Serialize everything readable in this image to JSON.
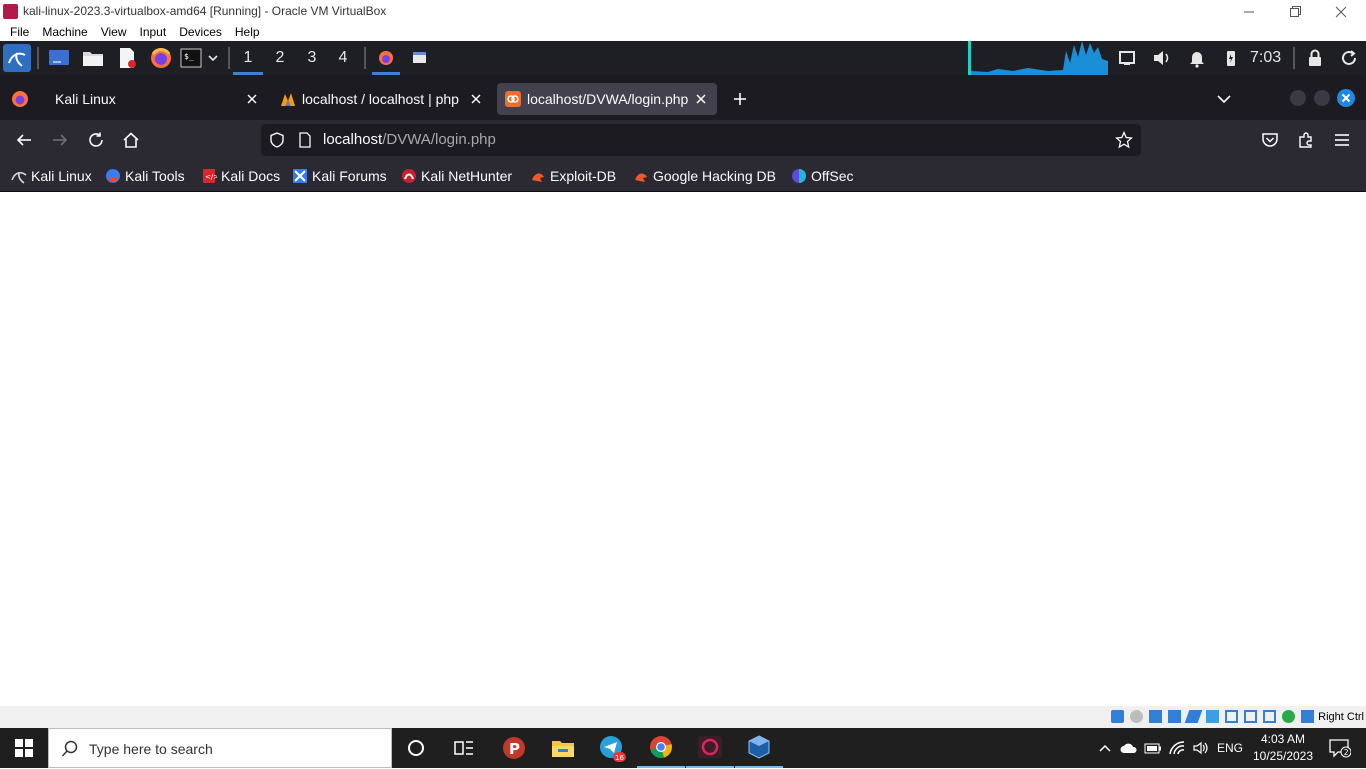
{
  "vbox": {
    "window_title": "kali-linux-2023.3-virtualbox-amd64 [Running] - Oracle VM VirtualBox",
    "menu": [
      "File",
      "Machine",
      "View",
      "Input",
      "Devices",
      "Help"
    ],
    "host_key": "Right Ctrl"
  },
  "kali_panel": {
    "workspaces": [
      "1",
      "2",
      "3",
      "4"
    ],
    "active_workspace": "1",
    "clock": "7:03"
  },
  "firefox": {
    "tabs": [
      {
        "title": "Kali Linux",
        "icon": "kali-icon",
        "active": false
      },
      {
        "title": "localhost / localhost | php",
        "icon": "phpmyadmin-icon",
        "active": false
      },
      {
        "title": "localhost/DVWA/login.php",
        "icon": "dvwa-icon",
        "active": true
      }
    ],
    "url_host": "localhost",
    "url_path": "/DVWA/login.php",
    "bookmarks": [
      {
        "label": "Kali Linux",
        "icon": "kali-dragon-icon"
      },
      {
        "label": "Kali Tools",
        "icon": "kali-tools-icon"
      },
      {
        "label": "Kali Docs",
        "icon": "kali-docs-icon"
      },
      {
        "label": "Kali Forums",
        "icon": "kali-forums-icon"
      },
      {
        "label": "Kali NetHunter",
        "icon": "nethunter-icon"
      },
      {
        "label": "Exploit-DB",
        "icon": "exploitdb-icon"
      },
      {
        "label": "Google Hacking DB",
        "icon": "ghdb-icon"
      },
      {
        "label": "OffSec",
        "icon": "offsec-icon"
      }
    ]
  },
  "windows": {
    "search_placeholder": "Type here to search",
    "telegram_badge": "16",
    "language": "ENG",
    "time": "4:03 AM",
    "date": "10/25/2023",
    "notifications_count": "2"
  },
  "colors": {
    "kali_panel_bg": "#1e1f24",
    "firefox_dark": "#1c1b22",
    "firefox_toolbar": "#2b2a33",
    "accent_blue": "#3b82d6"
  }
}
